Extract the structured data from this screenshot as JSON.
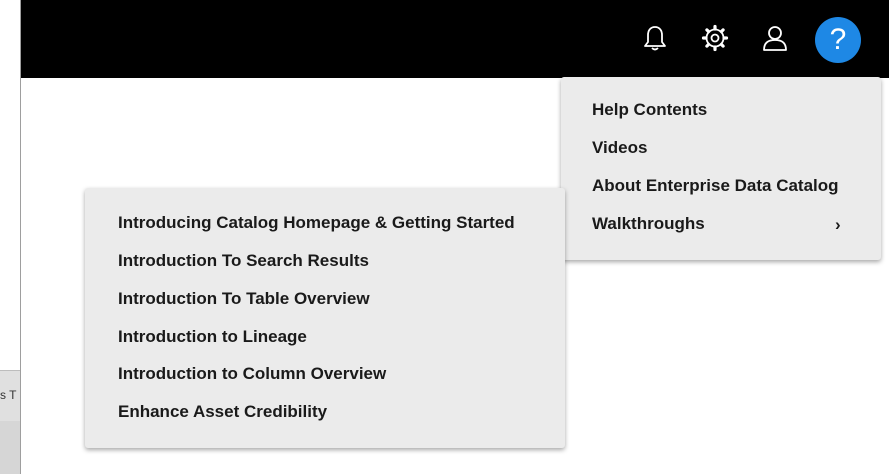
{
  "background_app": {
    "partial_text": "ss T"
  },
  "topbar": {
    "icons": [
      "bell-icon",
      "gear-icon",
      "user-icon",
      "help-icon"
    ],
    "help_label": "?"
  },
  "help_menu": {
    "items": [
      "Help Contents",
      "Videos",
      "About Enterprise Data Catalog",
      "Walkthroughs"
    ],
    "submenu_indicator": "›"
  },
  "walkthroughs_menu": {
    "items": [
      "Introducing Catalog Homepage & Getting Started",
      "Introduction To Search Results",
      "Introduction To Table Overview",
      "Introduction to Lineage",
      "Introduction to Column Overview",
      "Enhance Asset Credibility"
    ]
  },
  "colors": {
    "topbar": "#000000",
    "help_button": "#1e88e5",
    "menu_bg": "#ebebeb"
  }
}
